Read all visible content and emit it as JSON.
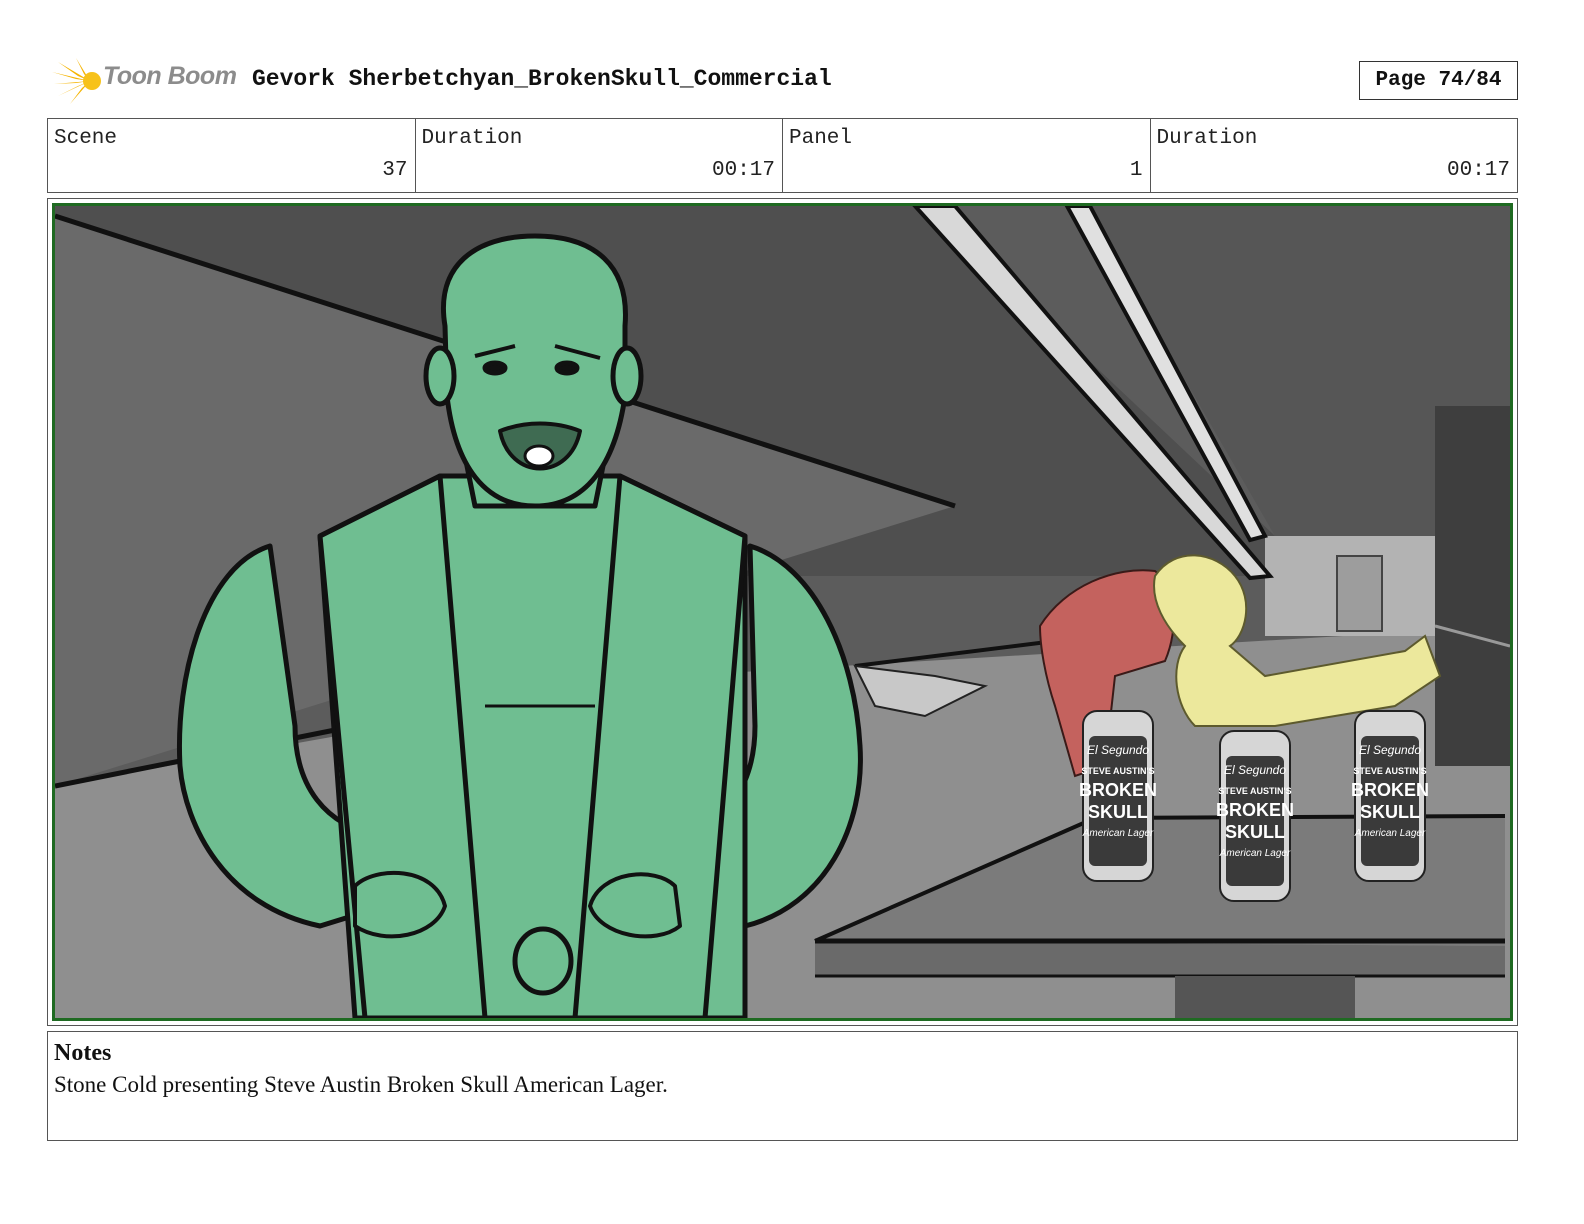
{
  "header": {
    "brand": "Toon Boom",
    "project_title": "Gevork Sherbetchyan_BrokenSkull_Commercial",
    "page_label": "Page 74/84"
  },
  "info": {
    "scene_label": "Scene",
    "scene_value": "37",
    "scene_duration_label": "Duration",
    "scene_duration_value": "00:17",
    "panel_label": "Panel",
    "panel_value": "1",
    "panel_duration_label": "Duration",
    "panel_duration_value": "00:17"
  },
  "cans": {
    "brand_script": "El Segundo",
    "line1": "STEVE AUSTIN'S",
    "line2": "BROKEN",
    "line3": "SKULL",
    "line4": "American Lager"
  },
  "notes": {
    "title": "Notes",
    "text": "Stone Cold presenting Steve Austin Broken Skull American Lager."
  },
  "colors": {
    "character_green": "#6fbe91",
    "wrestler_red": "#c4625e",
    "wrestler_yellow": "#ece89c",
    "panel_border": "#1f6a22"
  }
}
